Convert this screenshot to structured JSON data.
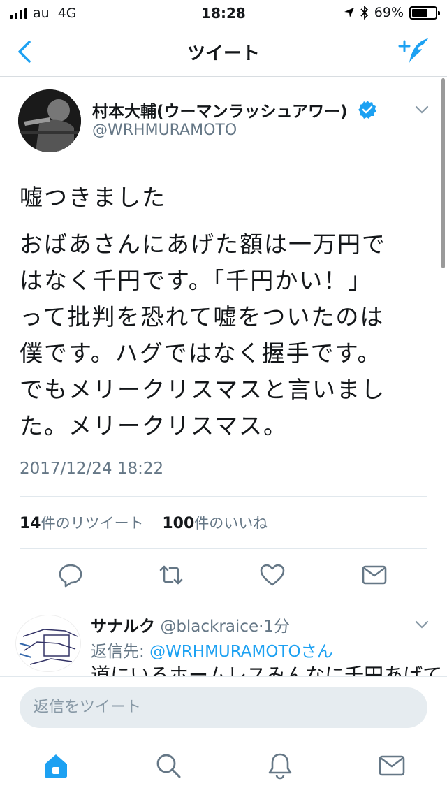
{
  "status_bar": {
    "carrier": "au",
    "network": "4G",
    "time": "18:28",
    "battery": "69%",
    "battery_level": 0.69
  },
  "nav": {
    "title": "ツイート",
    "accent_color": "#1da1f2"
  },
  "tweet": {
    "author_name": "村本大輔(ウーマンラッシュアワー)",
    "author_handle": "@WRHMURAMOTO",
    "verified": true,
    "text_line1": "嘘つきました",
    "text_lines": [
      "おばあさんにあげた額は一万円で",
      "はなく千円です。「千円かい！」",
      "って批判を恐れて嘘をついたのは",
      "僕です。ハグではなく握手です。",
      "でもメリークリスマスと言いまし",
      "た。メリークリスマス。"
    ],
    "timestamp": "2017/12/24 18:22",
    "retweet_count": "14",
    "retweet_label": "件のリツイート",
    "like_count": "100",
    "like_label": "件のいいね"
  },
  "actions": {
    "icons": [
      "reply-icon",
      "retweet-icon",
      "like-icon",
      "dm-icon"
    ]
  },
  "reply": {
    "name": "サナルク",
    "handle": "@blackraice",
    "time": "1分",
    "reply_to_prefix": "返信先:",
    "reply_to_handle": "@WRHMURAMOTOさん",
    "text": "道にいるホームレスみんなに千円あげてろ"
  },
  "reply_box": {
    "placeholder": "返信をツイート"
  },
  "tabbar": {
    "tabs": [
      "home-icon",
      "search-icon",
      "notifications-icon",
      "messages-icon"
    ]
  }
}
